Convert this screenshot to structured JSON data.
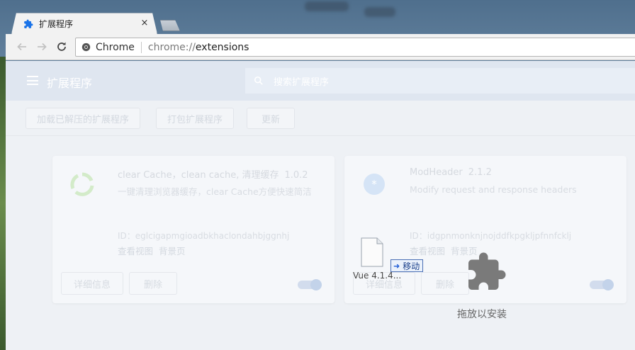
{
  "browser": {
    "tab_title": "扩展程序",
    "tab_close": "×",
    "omnibox": {
      "site_chip": "Chrome",
      "url_scheme": "chrome://",
      "url_host": "extensions"
    }
  },
  "extensions_page": {
    "title": "扩展程序",
    "search_placeholder": "搜索扩展程序",
    "actions": {
      "load_unpacked": "加载已解压的扩展程序",
      "pack": "打包扩展程序",
      "update": "更新"
    },
    "cards": [
      {
        "name": "clear Cache，clean cache, 清理缓存",
        "version": "1.0.2",
        "description": "一键清理浏览器缓存，clear Cache方便快速简洁",
        "id_line": "ID：eglcigapmgioadbkhaclondahbjggnhj",
        "links": [
          "查看视图",
          "背景页"
        ],
        "details_label": "详细信息",
        "remove_label": "删除",
        "enabled": true
      },
      {
        "name": "ModHeader",
        "version": "2.1.2",
        "description": "Modify request and response headers",
        "id_line": "ID：idgpnmonknjnojddfkpgkljpfnnfcklj",
        "links": [
          "查看视图",
          "背景页"
        ],
        "details_label": "详细信息",
        "remove_label": "删除",
        "enabled": true
      }
    ]
  },
  "drag_overlay": {
    "file_name": "Vue 4.1.4...",
    "move_hint": "移动",
    "drop_message": "拖放以安装"
  },
  "colors": {
    "accent": "#1a73e8",
    "header_bg": "#dfe6f0",
    "page_bg": "#eef1f5",
    "puzzle_gray": "#7a7a7a"
  }
}
